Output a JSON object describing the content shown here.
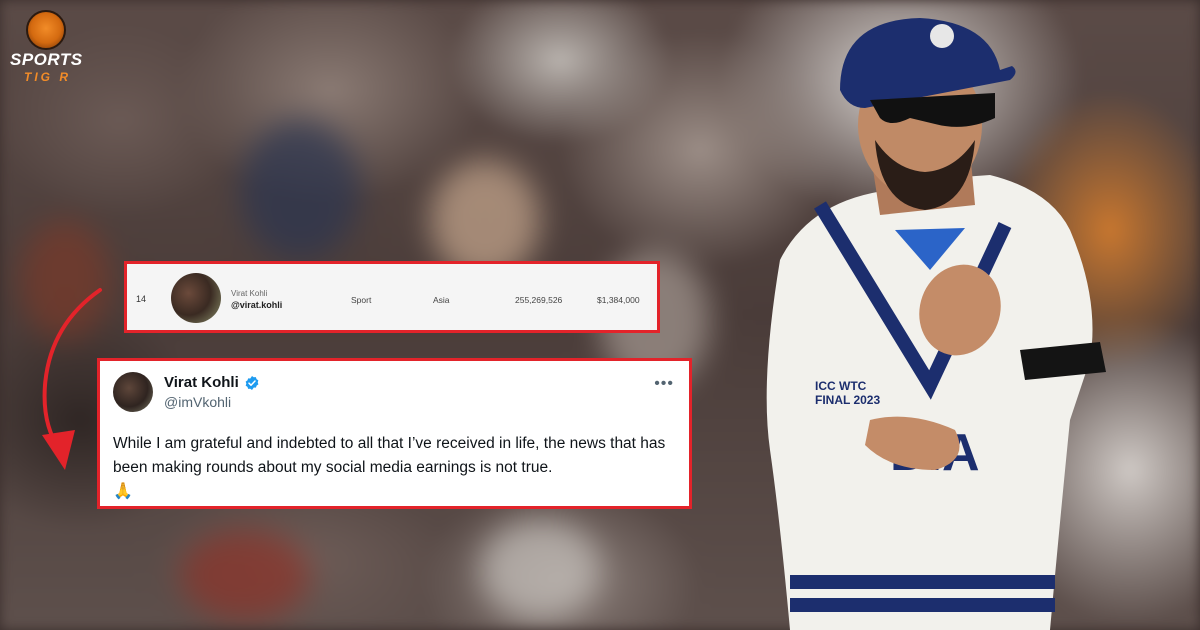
{
  "brand": {
    "line1": "SPORTS",
    "line2": "TIG  R"
  },
  "ranking_row": {
    "rank": "14",
    "name": "Virat Kohli",
    "handle": "@virat.kohli",
    "category": "Sport",
    "region": "Asia",
    "followers": "255,269,526",
    "price_per_post": "$1,384,000"
  },
  "tweet": {
    "display_name": "Virat Kohli",
    "verified_icon": "verified-badge-icon",
    "handle": "@imVkohli",
    "more_icon": "•••",
    "text": "While I am grateful and indebted to all that I’ve received in life, the news that has been making rounds about my social media earnings is not true.",
    "emoji": "🙏"
  },
  "colors": {
    "highlight_border": "#e3232a",
    "verified_blue": "#1d9bf0",
    "brand_orange": "#f28c28"
  }
}
